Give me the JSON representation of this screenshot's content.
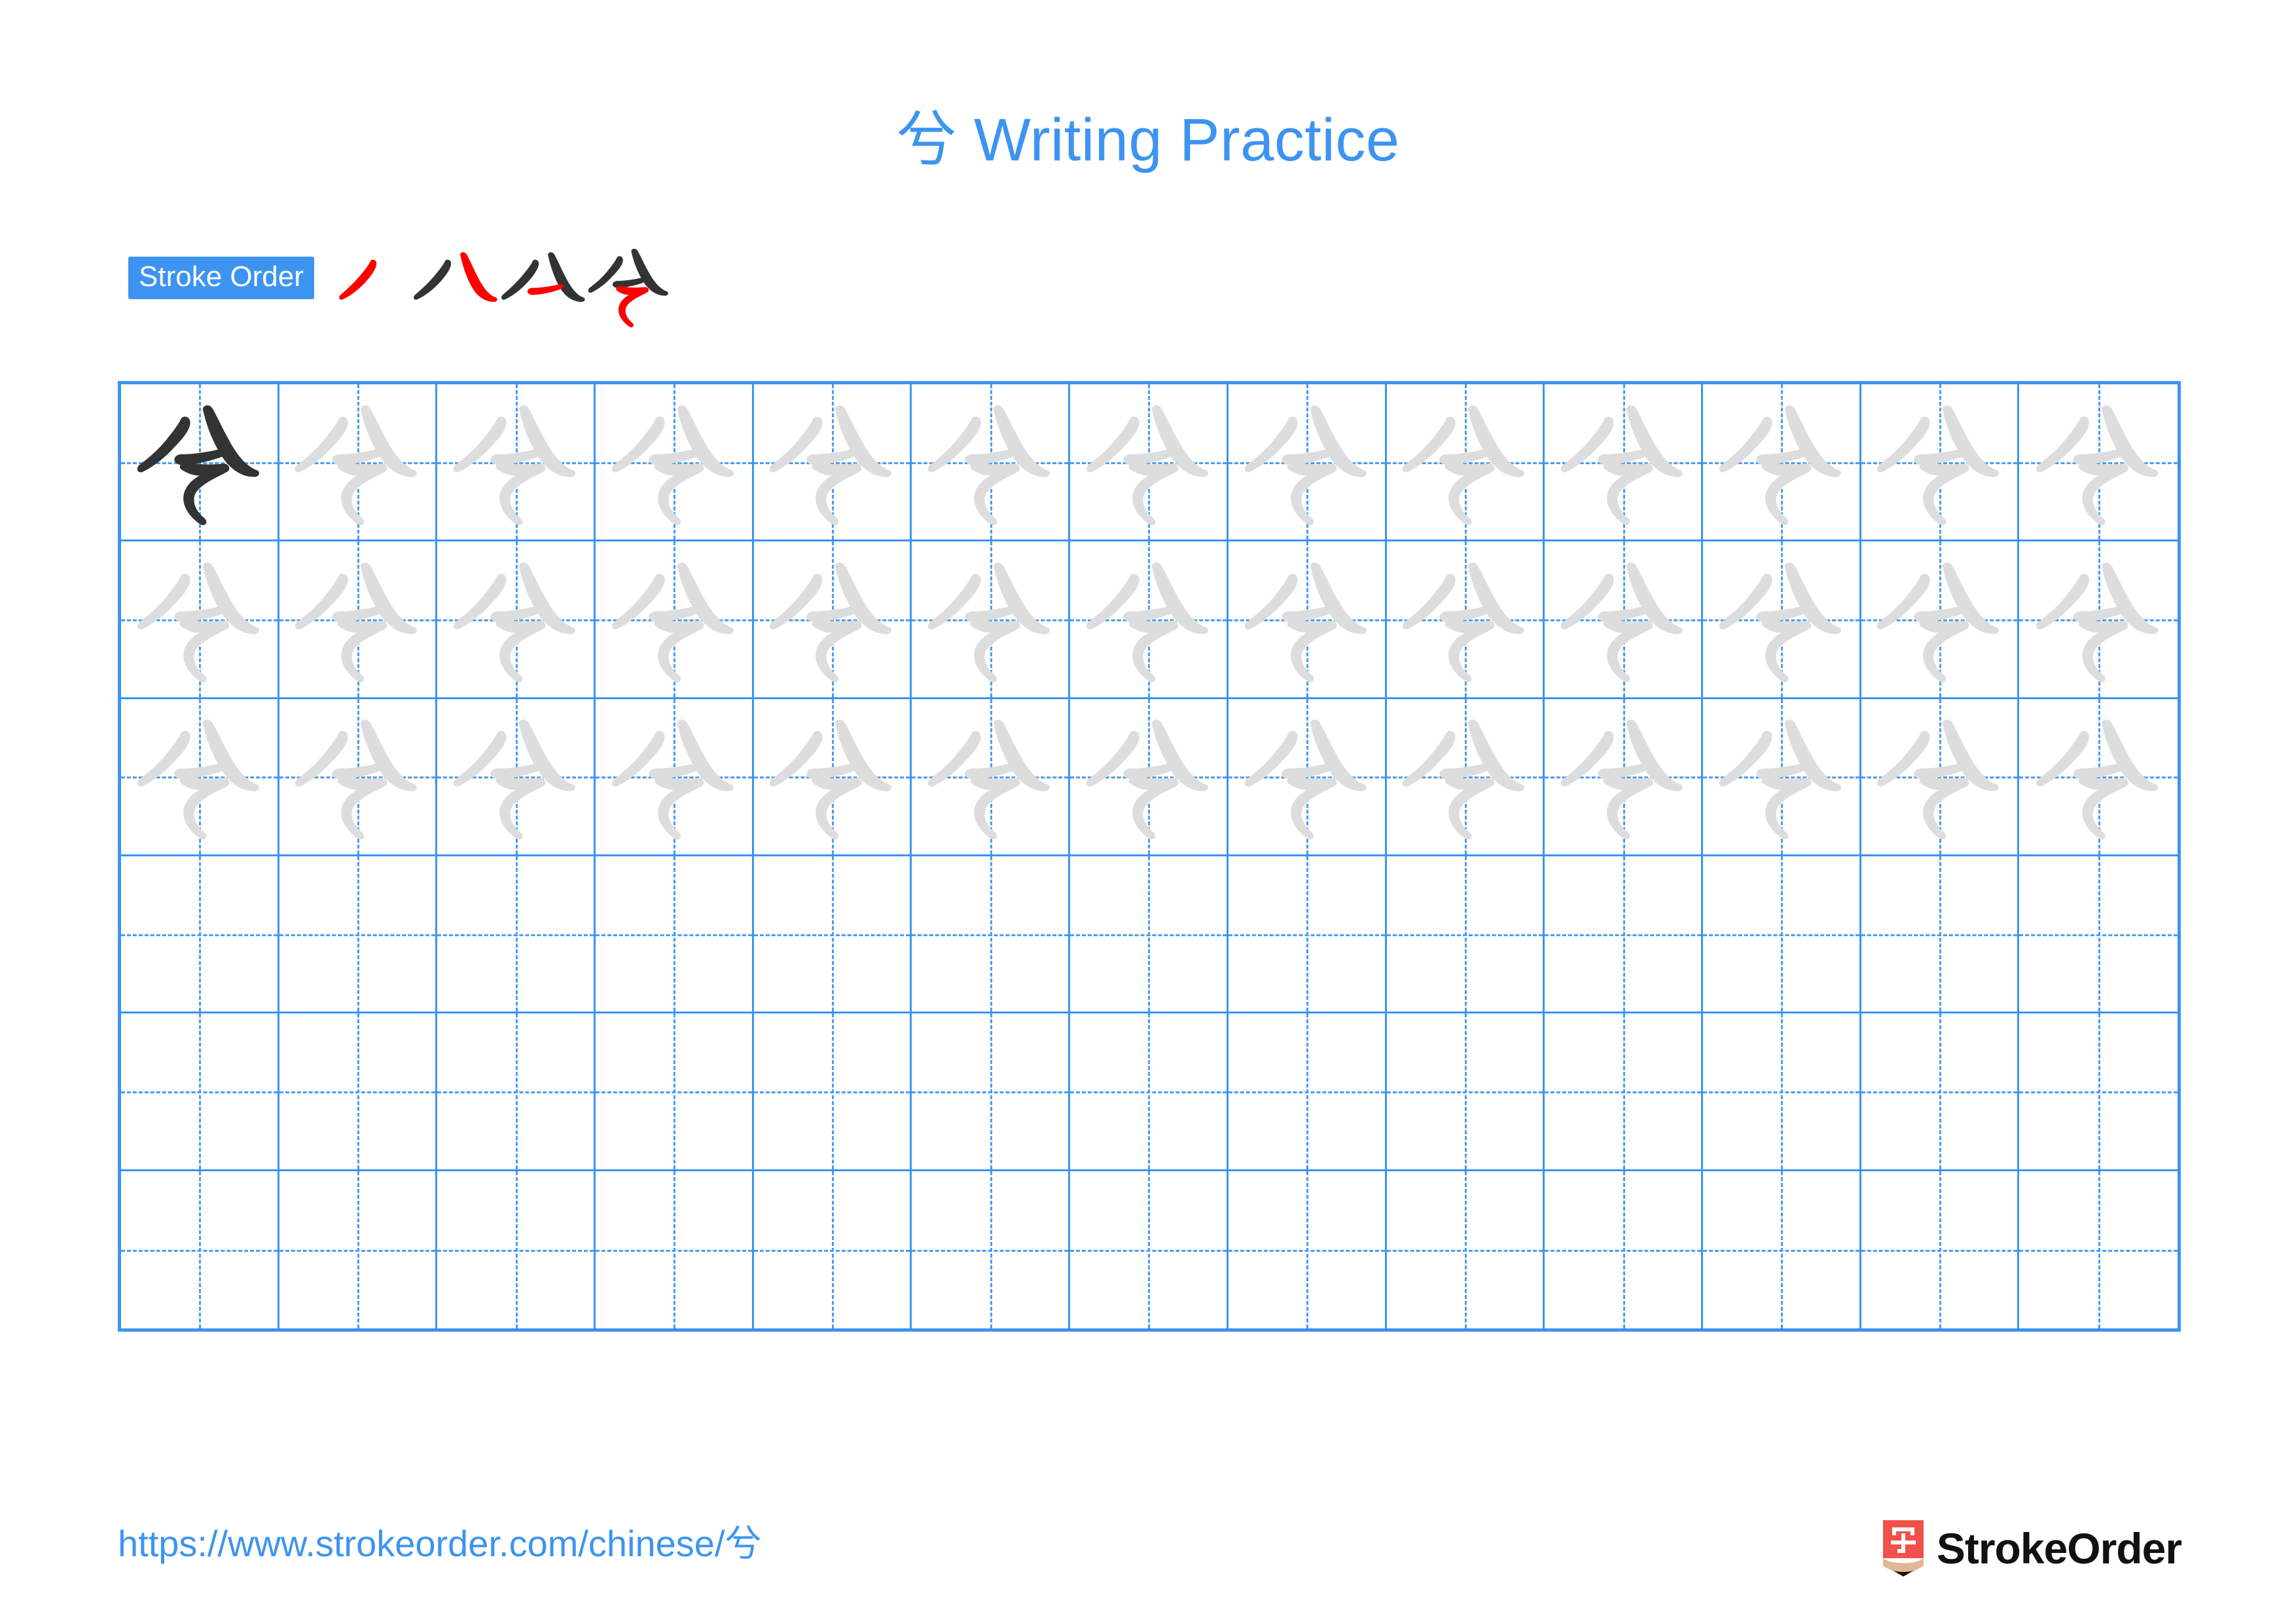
{
  "character": "兮",
  "title": "兮 Writing Practice",
  "colors": {
    "accent_blue": "#3d94f0",
    "grid_line": "#3d94f0",
    "grid_guide": "#4a9df2",
    "stroke_new": "#ff0000",
    "stroke_done": "#333333",
    "trace_gray": "#dddddd",
    "logo_red": "#f2504b",
    "logo_wood": "#e0b894",
    "logo_text": "#111111"
  },
  "stroke_order": {
    "label": "Stroke Order",
    "stroke_count": 4,
    "steps": [
      {
        "index": 1,
        "name": "stroke-step-1",
        "new_stroke": "撇",
        "strokes_shown": 1
      },
      {
        "index": 2,
        "name": "stroke-step-2",
        "new_stroke": "捺",
        "strokes_shown": 2
      },
      {
        "index": 3,
        "name": "stroke-step-3",
        "new_stroke": "横",
        "strokes_shown": 3
      },
      {
        "index": 4,
        "name": "stroke-step-4",
        "new_stroke": "横折弯钩",
        "strokes_shown": 4
      }
    ]
  },
  "grid": {
    "columns": 13,
    "rows": 6,
    "guide_style": "dashed-crosshair",
    "rows_data": [
      {
        "row": 1,
        "cells": [
          "dark",
          "light",
          "light",
          "light",
          "light",
          "light",
          "light",
          "light",
          "light",
          "light",
          "light",
          "light",
          "light"
        ]
      },
      {
        "row": 2,
        "cells": [
          "light",
          "light",
          "light",
          "light",
          "light",
          "light",
          "light",
          "light",
          "light",
          "light",
          "light",
          "light",
          "light"
        ]
      },
      {
        "row": 3,
        "cells": [
          "light",
          "light",
          "light",
          "light",
          "light",
          "light",
          "light",
          "light",
          "light",
          "light",
          "light",
          "light",
          "light"
        ]
      },
      {
        "row": 4,
        "cells": [
          "empty",
          "empty",
          "empty",
          "empty",
          "empty",
          "empty",
          "empty",
          "empty",
          "empty",
          "empty",
          "empty",
          "empty",
          "empty"
        ]
      },
      {
        "row": 5,
        "cells": [
          "empty",
          "empty",
          "empty",
          "empty",
          "empty",
          "empty",
          "empty",
          "empty",
          "empty",
          "empty",
          "empty",
          "empty",
          "empty"
        ]
      },
      {
        "row": 6,
        "cells": [
          "empty",
          "empty",
          "empty",
          "empty",
          "empty",
          "empty",
          "empty",
          "empty",
          "empty",
          "empty",
          "empty",
          "empty",
          "empty"
        ]
      }
    ]
  },
  "footer": {
    "url": "https://www.strokeorder.com/chinese/兮",
    "brand_name": "StrokeOrder",
    "brand_mark_char": "字"
  }
}
